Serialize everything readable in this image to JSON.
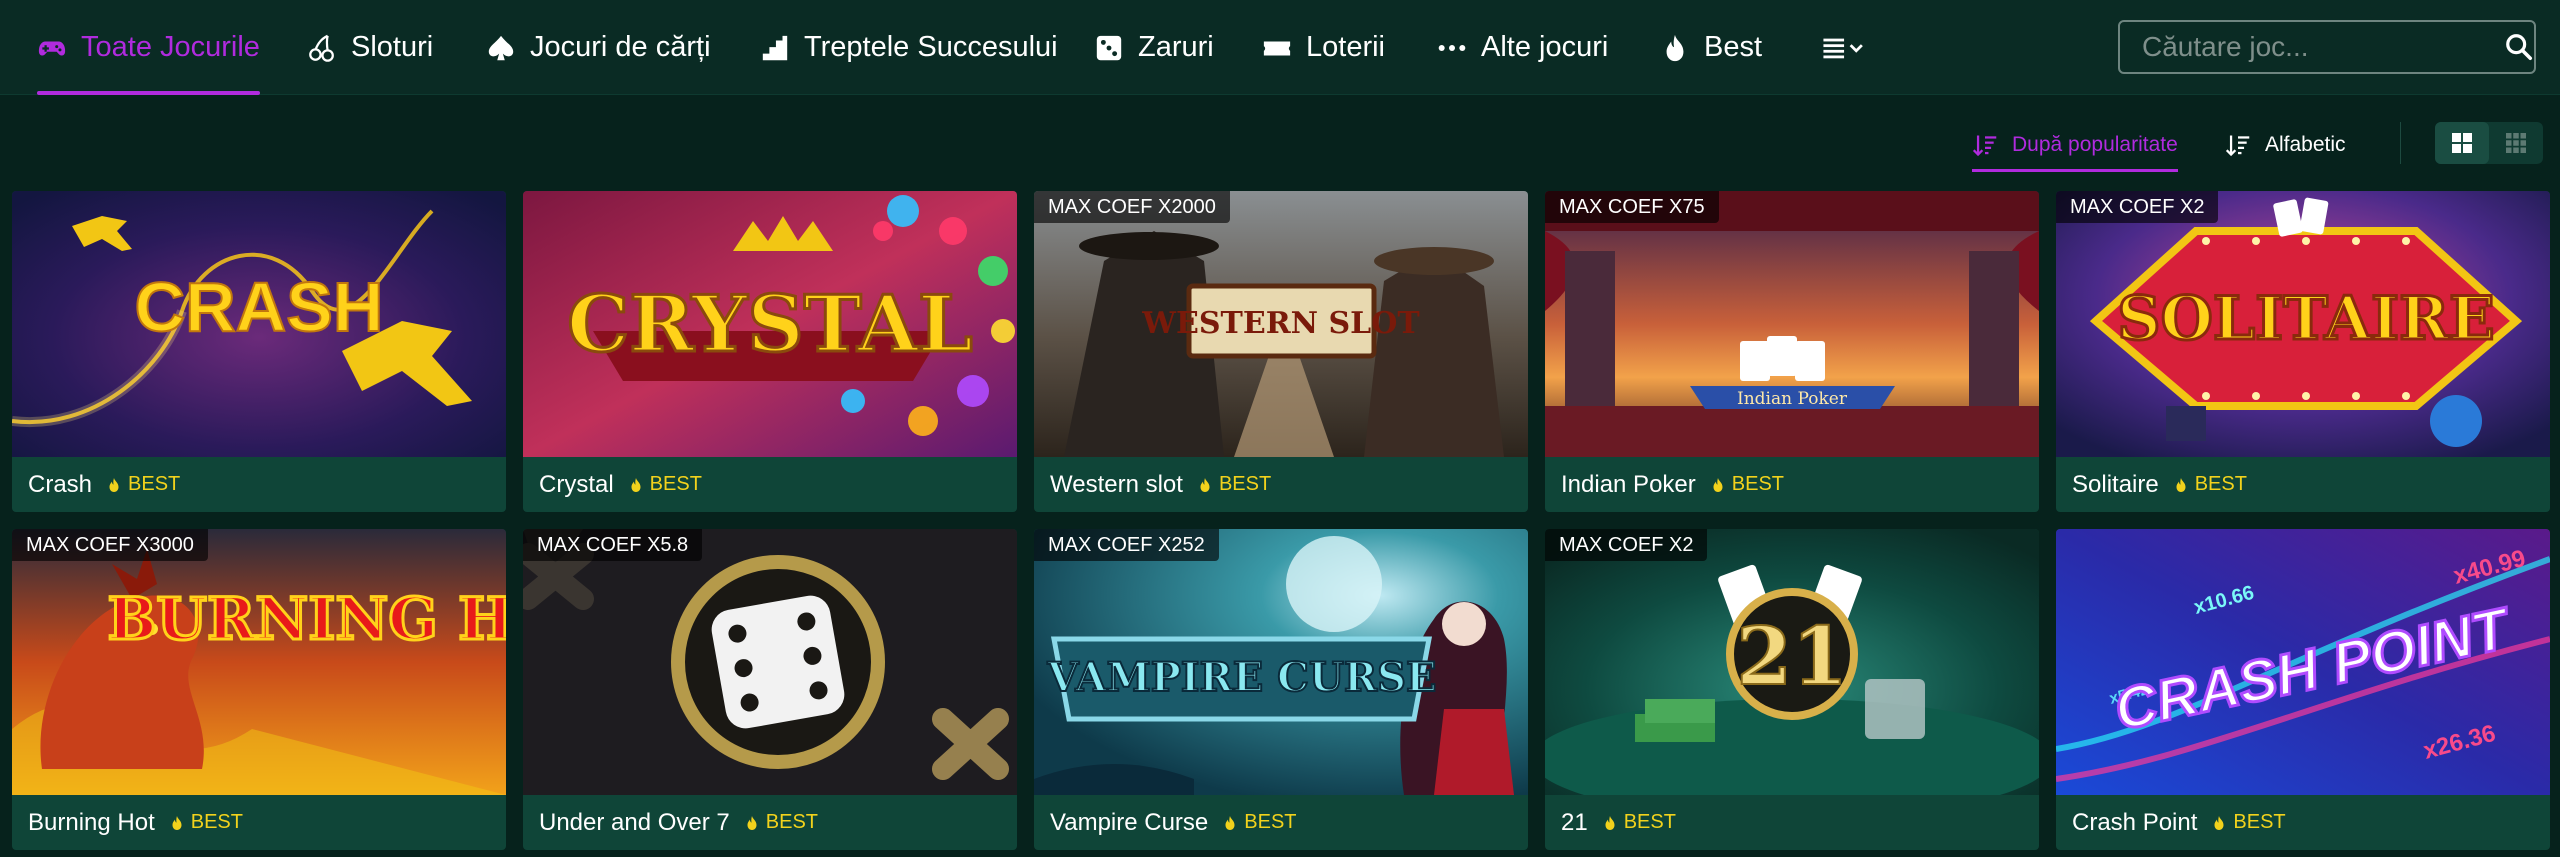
{
  "nav": {
    "items": [
      {
        "label": "Toate Jocurile",
        "icon": "gamepad-icon",
        "active": true
      },
      {
        "label": "Sloturi",
        "icon": "cherries-icon"
      },
      {
        "label": "Jocuri de cărți",
        "icon": "spade-icon"
      },
      {
        "label": "Treptele Succesului",
        "icon": "stairs-icon"
      },
      {
        "label": "Zaruri",
        "icon": "dice-icon"
      },
      {
        "label": "Loterii",
        "icon": "ticket-icon"
      },
      {
        "label": "Alte jocuri",
        "icon": "more-dots-icon"
      },
      {
        "label": "Best",
        "icon": "flame-icon"
      }
    ],
    "more_menu_icon": "list-chevron-icon",
    "accent_color": "#b02bde"
  },
  "search": {
    "placeholder": "Căutare joc...",
    "value": ""
  },
  "sort": {
    "options": [
      {
        "label": "După popularitate",
        "active": true
      },
      {
        "label": "Alfabetic",
        "active": false
      }
    ]
  },
  "view": {
    "options": [
      "grid-large-icon",
      "grid-small-icon"
    ],
    "active": "grid-large-icon"
  },
  "games": [
    {
      "name": "Crash",
      "badge": "BEST",
      "coef": "",
      "art": "CRASH"
    },
    {
      "name": "Crystal",
      "badge": "BEST",
      "coef": "",
      "art": "CRYSTAL"
    },
    {
      "name": "Western slot",
      "badge": "BEST",
      "coef": "MAX COEF X2000",
      "art": "WESTERN SLOT"
    },
    {
      "name": "Indian Poker",
      "badge": "BEST",
      "coef": "MAX COEF X75",
      "art": "Indian Poker"
    },
    {
      "name": "Solitaire",
      "badge": "BEST",
      "coef": "MAX COEF X2",
      "art": "SOLITAIRE"
    },
    {
      "name": "Burning Hot",
      "badge": "BEST",
      "coef": "MAX COEF X3000",
      "art": "BURNING HOT"
    },
    {
      "name": "Under and Over 7",
      "badge": "BEST",
      "coef": "MAX COEF X5.8",
      "art": ""
    },
    {
      "name": "Vampire Curse",
      "badge": "BEST",
      "coef": "MAX COEF X252",
      "art": "VAMPIRE CURSE"
    },
    {
      "name": "21",
      "badge": "BEST",
      "coef": "MAX COEF X2",
      "art": "21"
    },
    {
      "name": "Crash Point",
      "badge": "BEST",
      "coef": "",
      "art": "CRASH POINT"
    }
  ],
  "art_extras": {
    "crash_point": [
      "x10.66",
      "x40.99",
      "x26.36",
      "x5.42"
    ]
  },
  "colors": {
    "background": "#06221c",
    "nav_bg": "#0a2b24",
    "card_footer": "#0f4538",
    "badge_yellow": "#f2d21c"
  }
}
